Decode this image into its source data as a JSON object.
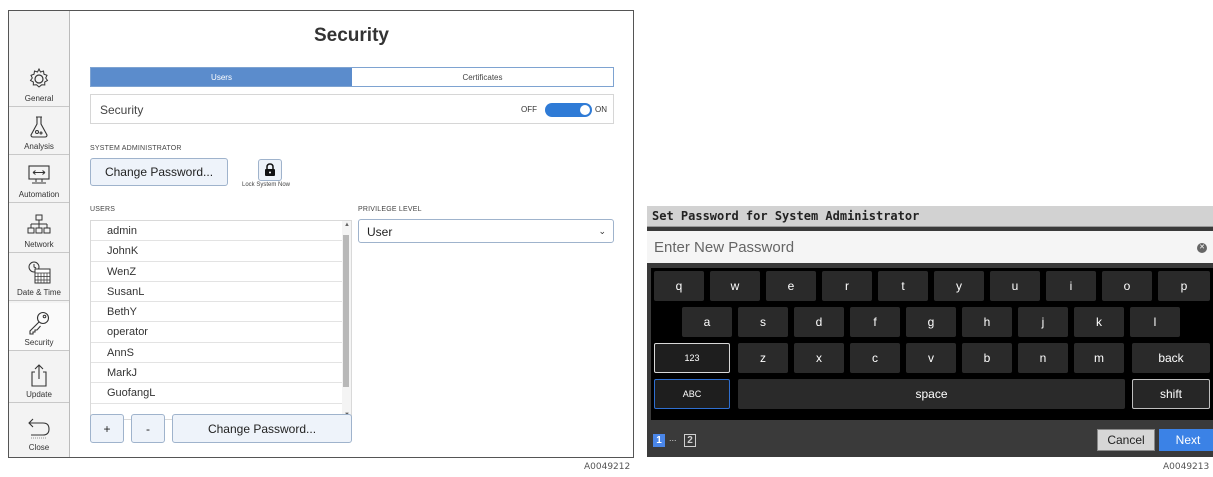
{
  "left_panel": {
    "title": "Security",
    "sidebar": {
      "items": [
        {
          "label": "General",
          "icon": "gear-icon"
        },
        {
          "label": "Analysis",
          "icon": "flask-icon"
        },
        {
          "label": "Automation",
          "icon": "monitor-arrows-icon"
        },
        {
          "label": "Network",
          "icon": "network-icon"
        },
        {
          "label": "Date & Time",
          "icon": "calendar-clock-icon"
        },
        {
          "label": "Security",
          "icon": "key-icon"
        },
        {
          "label": "Update",
          "icon": "upload-icon"
        },
        {
          "label": "Close",
          "icon": "back-arrow-icon"
        }
      ]
    },
    "tabs": [
      {
        "label": "Users",
        "active": true
      },
      {
        "label": "Certificates",
        "active": false
      }
    ],
    "security_toggle": {
      "label": "Security",
      "off_label": "OFF",
      "on_label": "ON",
      "state": "on"
    },
    "system_admin": {
      "section_label": "SYSTEM ADMINISTRATOR",
      "change_password_label": "Change Password...",
      "lock_label": "Lock System Now"
    },
    "users": {
      "section_label": "USERS",
      "list": [
        "admin",
        "JohnK",
        "WenZ",
        "SusanL",
        "BethY",
        "operator",
        "AnnS",
        "MarkJ",
        "GuofangL"
      ],
      "add_label": "+",
      "remove_label": "-",
      "change_password_label": "Change Password..."
    },
    "privilege": {
      "section_label": "PRIVILEGE LEVEL",
      "value": "User"
    },
    "caption": "A0049212"
  },
  "right_panel": {
    "title": "Set Password for System Administrator",
    "password_placeholder": "Enter New Password",
    "keyboard": {
      "row1": [
        "q",
        "w",
        "e",
        "r",
        "t",
        "y",
        "u",
        "i",
        "o",
        "p"
      ],
      "row2": [
        "a",
        "s",
        "d",
        "f",
        "g",
        "h",
        "j",
        "k",
        "l"
      ],
      "row3": [
        "123",
        "z",
        "x",
        "c",
        "v",
        "b",
        "n",
        "m",
        "back"
      ],
      "row4": [
        "ABC",
        "space",
        "shift"
      ]
    },
    "pages": {
      "current": "1",
      "separator": "...",
      "other": "2"
    },
    "cancel_label": "Cancel",
    "next_label": "Next",
    "caption": "A0049213"
  },
  "colors": {
    "accent": "#5b8ccc",
    "toggle_on": "#2f7bd6",
    "next_button": "#3b82e6",
    "keyboard_bg": "#000000"
  }
}
